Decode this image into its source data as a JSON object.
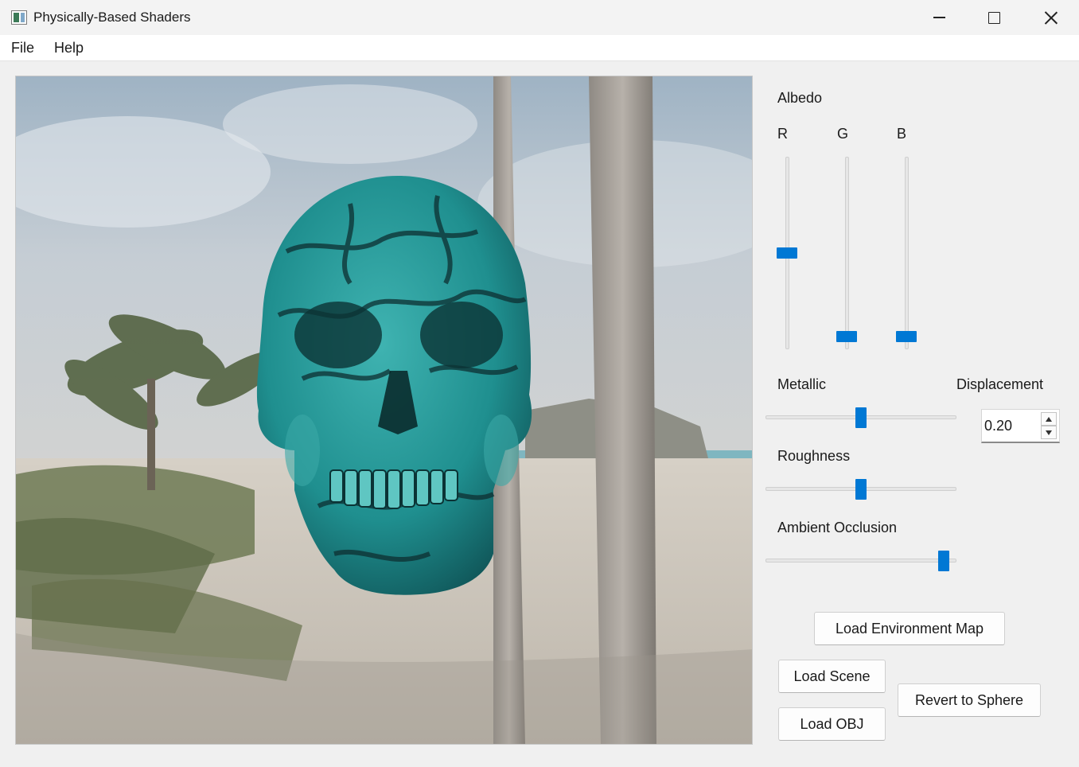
{
  "window": {
    "title": "Physically-Based Shaders",
    "icon": "app-window-icon"
  },
  "menu": {
    "items": [
      {
        "label": "File"
      },
      {
        "label": "Help"
      }
    ]
  },
  "viewport": {
    "scene": "beach-environment-map",
    "model": "skull-mesh",
    "accent_model_color": "#1f8f8f"
  },
  "controls": {
    "albedo": {
      "label": "Albedo",
      "channels": [
        {
          "label": "R",
          "value": 0.5
        },
        {
          "label": "G",
          "value": 0.04
        },
        {
          "label": "B",
          "value": 0.04
        }
      ]
    },
    "metallic": {
      "label": "Metallic",
      "value": 0.5
    },
    "roughness": {
      "label": "Roughness",
      "value": 0.5
    },
    "ambient_occlusion": {
      "label": "Ambient Occlusion",
      "value": 0.96
    },
    "displacement": {
      "label": "Displacement",
      "value": "0.20"
    }
  },
  "buttons": {
    "load_env_map": "Load Environment Map",
    "load_scene": "Load Scene",
    "load_obj": "Load OBJ",
    "revert_sphere": "Revert to Sphere"
  },
  "colors": {
    "accent": "#0078d4",
    "panel_bg": "#f0f0f0"
  }
}
